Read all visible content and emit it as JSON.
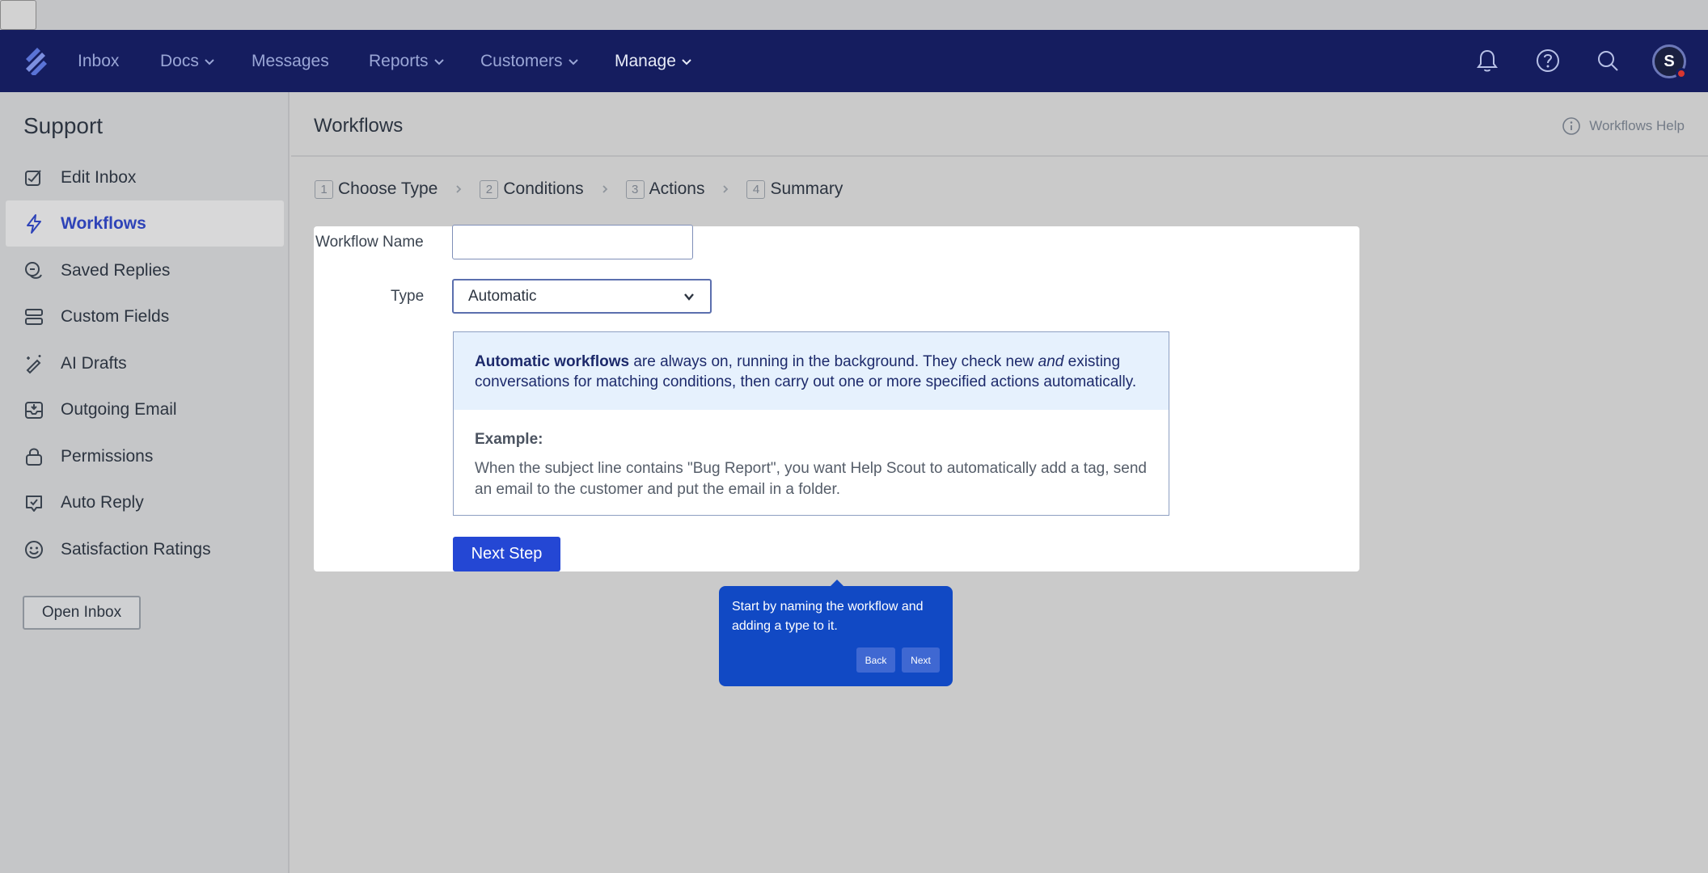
{
  "nav": {
    "items": [
      {
        "label": "Inbox",
        "has_menu": false
      },
      {
        "label": "Docs",
        "has_menu": true
      },
      {
        "label": "Messages",
        "has_menu": false
      },
      {
        "label": "Reports",
        "has_menu": true
      },
      {
        "label": "Customers",
        "has_menu": true
      },
      {
        "label": "Manage",
        "has_menu": true
      }
    ],
    "active": "Manage",
    "avatar_initial": "S",
    "icons": [
      "bell-icon",
      "help-icon",
      "search-icon"
    ]
  },
  "sidebar": {
    "title": "Support",
    "items": [
      {
        "label": "Edit Inbox",
        "icon": "edit-inbox-icon"
      },
      {
        "label": "Workflows",
        "icon": "lightning-icon"
      },
      {
        "label": "Saved Replies",
        "icon": "chat-bubbles-icon"
      },
      {
        "label": "Custom Fields",
        "icon": "fields-icon"
      },
      {
        "label": "AI Drafts",
        "icon": "magic-pen-icon"
      },
      {
        "label": "Outgoing Email",
        "icon": "outbox-icon"
      },
      {
        "label": "Permissions",
        "icon": "lock-icon"
      },
      {
        "label": "Auto Reply",
        "icon": "auto-reply-icon"
      },
      {
        "label": "Satisfaction Ratings",
        "icon": "smiley-icon"
      }
    ],
    "active": "Workflows",
    "open_inbox_label": "Open Inbox"
  },
  "header": {
    "title": "Workflows",
    "help_label": "Workflows Help"
  },
  "steps": [
    {
      "num": "1",
      "label": "Choose Type"
    },
    {
      "num": "2",
      "label": "Conditions"
    },
    {
      "num": "3",
      "label": "Actions"
    },
    {
      "num": "4",
      "label": "Summary"
    }
  ],
  "form": {
    "name_label": "Workflow Name",
    "name_value": "",
    "name_placeholder": "",
    "type_label": "Type",
    "type_value": "Automatic",
    "info": {
      "bold": "Automatic workflows",
      "text1": " are always on, running in the background. They check new ",
      "italic": "and",
      "text2": " existing conversations for matching conditions, then carry out one or more specified actions automatically.",
      "example_label": "Example:",
      "example_text": "When the subject line contains \"Bug Report\", you want Help Scout to automatically add a tag, send an email to the customer and put the email in a folder."
    },
    "next_label": "Next Step"
  },
  "tooltip": {
    "text": "Start by naming the workflow and adding a type to it.",
    "back_label": "Back",
    "next_label": "Next"
  },
  "colors": {
    "navbar": "#151d5f",
    "accent": "#2447d4",
    "tooltip": "#1149c4",
    "active_sidebar_text": "#2e43b8"
  }
}
